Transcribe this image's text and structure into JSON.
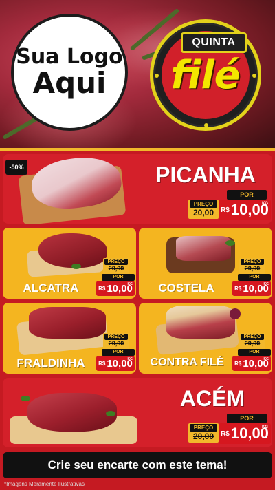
{
  "header": {
    "logo": {
      "line1": "Sua Logo",
      "line2": "Aqui"
    },
    "badge": {
      "top": "QUINTA",
      "main": "filé"
    }
  },
  "featured": {
    "discount": "-50%",
    "name": "PICANHA",
    "label_preco": "PREÇO",
    "old_price": "20,00",
    "label_por": "POR",
    "currency": "R$",
    "new_price": "10,00",
    "unit": "KG"
  },
  "products": [
    {
      "name": "ALCATRA",
      "label_preco": "PREÇO",
      "old_price": "20,00",
      "label_por": "POR",
      "currency": "R$",
      "new_price": "10,00",
      "unit": "KG"
    },
    {
      "name": "COSTELA",
      "label_preco": "PREÇO",
      "old_price": "20,00",
      "label_por": "POR",
      "currency": "R$",
      "new_price": "10,00",
      "unit": "KG"
    },
    {
      "name": "FRALDINHA",
      "label_preco": "PREÇO",
      "old_price": "20,00",
      "label_por": "POR",
      "currency": "R$",
      "new_price": "10,00",
      "unit": "KG"
    },
    {
      "name": "CONTRA FILÉ",
      "label_preco": "PREÇO",
      "old_price": "20,00",
      "label_por": "POR",
      "currency": "R$",
      "new_price": "10,00",
      "unit": "KG"
    }
  ],
  "bottom_feature": {
    "name": "ACÉM",
    "label_preco": "PREÇO",
    "old_price": "20,00",
    "label_por": "POR",
    "currency": "R$",
    "new_price": "10,00",
    "unit": "KG"
  },
  "footer": {
    "cta": "Crie seu encarte com este tema!",
    "disclaimer": "*Imagens Meramente Ilustrativas"
  },
  "colors": {
    "red": "#d4202a",
    "yellow": "#f4b520",
    "black": "#111111",
    "badge_yellow": "#f3e600"
  }
}
